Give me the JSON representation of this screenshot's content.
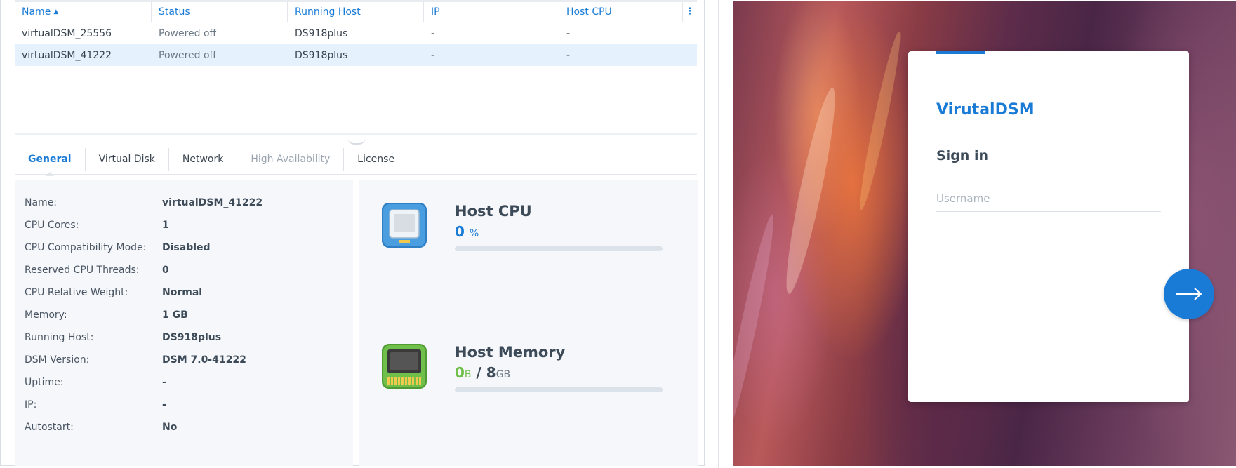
{
  "vm_table": {
    "columns": [
      {
        "label": "Name",
        "sorted": "ascending"
      },
      {
        "label": "Status"
      },
      {
        "label": "Running Host"
      },
      {
        "label": "IP"
      },
      {
        "label": "Host CPU"
      }
    ],
    "more_icon": "kebab-menu-icon",
    "rows": [
      {
        "name": "virtualDSM_25556",
        "status": "Powered off",
        "host": "DS918plus",
        "ip": "-",
        "cpu": "-",
        "selected": false
      },
      {
        "name": "virtualDSM_41222",
        "status": "Powered off",
        "host": "DS918plus",
        "ip": "-",
        "cpu": "-",
        "selected": true
      }
    ]
  },
  "tabs": [
    {
      "label": "General",
      "state": "active"
    },
    {
      "label": "Virtual Disk",
      "state": "normal"
    },
    {
      "label": "Network",
      "state": "normal"
    },
    {
      "label": "High Availability",
      "state": "disabled"
    },
    {
      "label": "License",
      "state": "normal"
    }
  ],
  "general": {
    "rows": [
      {
        "label": "Name:",
        "value": "virtualDSM_41222"
      },
      {
        "label": "CPU Cores:",
        "value": "1"
      },
      {
        "label": "CPU Compatibility Mode:",
        "value": "Disabled"
      },
      {
        "label": "Reserved CPU Threads:",
        "value": "0"
      },
      {
        "label": "CPU Relative Weight:",
        "value": "Normal"
      },
      {
        "label": "Memory:",
        "value": "1 GB"
      },
      {
        "label": "Running Host:",
        "value": "DS918plus"
      },
      {
        "label": "DSM Version:",
        "value": "DSM 7.0-41222"
      },
      {
        "label": "Uptime:",
        "value": "-"
      },
      {
        "label": "IP:",
        "value": "-"
      },
      {
        "label": "Autostart:",
        "value": "No"
      }
    ]
  },
  "resources": {
    "cpu": {
      "title": "Host CPU",
      "value": "0",
      "unit": "%",
      "usage_fraction": 0,
      "icon": "cpu-chip-icon",
      "value_color": "#1a7bd6"
    },
    "memory": {
      "title": "Host Memory",
      "used": "0",
      "used_unit": "B",
      "sep": "/",
      "total": "8",
      "total_unit": "GB",
      "usage_fraction": 0,
      "icon": "memory-module-icon",
      "value_color": "#6fbf4a"
    }
  },
  "login": {
    "app_name": "VirutalDSM",
    "title": "Sign in",
    "username_placeholder": "Username",
    "username_value": "",
    "next_icon": "arrow-right-icon",
    "accent_color": "#1a7bd6"
  }
}
